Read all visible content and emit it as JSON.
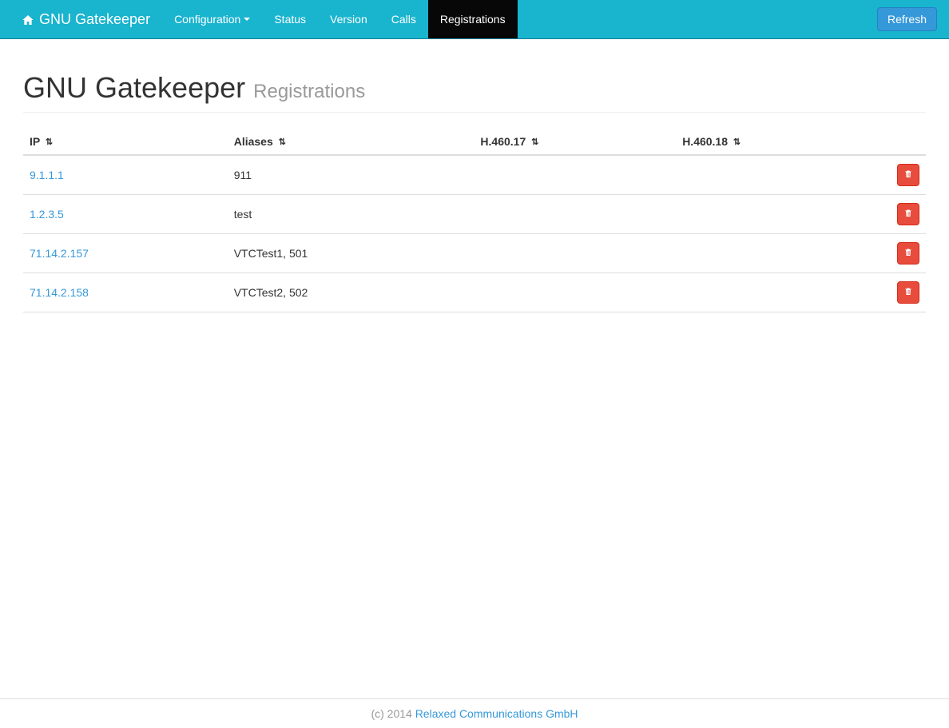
{
  "navbar": {
    "brand": "GNU Gatekeeper",
    "items": [
      {
        "label": "Configuration",
        "has_caret": true,
        "active": false
      },
      {
        "label": "Status",
        "has_caret": false,
        "active": false
      },
      {
        "label": "Version",
        "has_caret": false,
        "active": false
      },
      {
        "label": "Calls",
        "has_caret": false,
        "active": false
      },
      {
        "label": "Registrations",
        "has_caret": false,
        "active": true
      }
    ],
    "refresh_label": "Refresh"
  },
  "page": {
    "title": "GNU Gatekeeper",
    "subtitle": "Registrations"
  },
  "table": {
    "headers": {
      "ip": "IP",
      "aliases": "Aliases",
      "h46017": "H.460.17",
      "h46018": "H.460.18"
    },
    "rows": [
      {
        "ip": "9.1.1.1",
        "aliases": "911",
        "h46017": "",
        "h46018": ""
      },
      {
        "ip": "1.2.3.5",
        "aliases": "test",
        "h46017": "",
        "h46018": ""
      },
      {
        "ip": "71.14.2.157",
        "aliases": "VTCTest1, 501",
        "h46017": "",
        "h46018": ""
      },
      {
        "ip": "71.14.2.158",
        "aliases": "VTCTest2, 502",
        "h46017": "",
        "h46018": ""
      }
    ]
  },
  "footer": {
    "copyright": "(c) 2014 ",
    "link_text": "Relaxed Communications GmbH"
  }
}
